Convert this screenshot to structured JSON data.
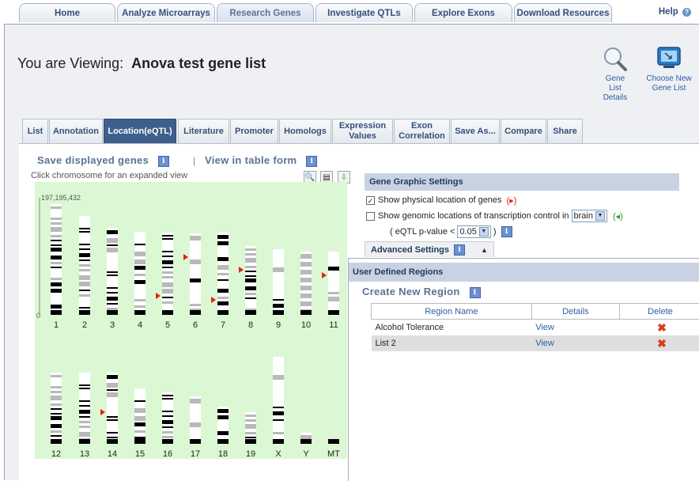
{
  "top_nav": {
    "tabs": [
      "Home",
      "Analyze Microarrays",
      "Research Genes",
      "Investigate QTLs",
      "Explore Exons",
      "Download Resources"
    ],
    "active": "Research Genes",
    "help": "Help"
  },
  "header": {
    "viewing_label": "You are Viewing:",
    "gene_list_name": "Anova test gene list",
    "gene_list_details": [
      "Gene List",
      "Details"
    ],
    "choose_new": [
      "Choose New",
      "Gene List"
    ]
  },
  "subtabs": {
    "items": [
      "List",
      "Annotation",
      "Location(eQTL)",
      "Literature",
      "Promoter",
      "Homologs",
      "Expression Values",
      "Exon Correlation",
      "Save As...",
      "Compare",
      "Share"
    ],
    "active": "Location(eQTL)"
  },
  "toolbar": {
    "save_displayed": "Save displayed genes",
    "separator": "|",
    "view_table": "View in table form"
  },
  "chromosome_view": {
    "hint": "Click chromosome for an expanded view",
    "scale_label": "197,195,432",
    "origin_label": "0",
    "row1": [
      "1",
      "2",
      "3",
      "4",
      "5",
      "6",
      "7",
      "8",
      "9",
      "10",
      "11"
    ],
    "row2": [
      "12",
      "13",
      "14",
      "15",
      "16",
      "17",
      "18",
      "19",
      "X",
      "Y",
      "MT"
    ],
    "colors": {
      "background": "#dcf7d4",
      "marker": "#e0240c"
    }
  },
  "settings": {
    "title": "Gene Graphic Settings",
    "physical_location": "Show physical location of genes",
    "genomic_locations": "Show genomic locations of transcription control in",
    "tissue_value": "brain",
    "pvalue_label": "( eQTL p-value <",
    "pvalue_value": "0.05",
    "pvalue_close": ")",
    "advanced": "Advanced Settings"
  },
  "user_regions": {
    "title": "User Defined Regions",
    "create_button": "Create New Region",
    "columns": [
      "Region Name",
      "Details",
      "Delete"
    ],
    "rows": [
      {
        "name": "Alcohol Tolerance",
        "details": "View"
      },
      {
        "name": "List 2",
        "details": "View"
      }
    ]
  },
  "colors": {
    "accent": "#3e5f8c",
    "link": "#2d5ca8",
    "header_bar": "#c9d2e3"
  }
}
